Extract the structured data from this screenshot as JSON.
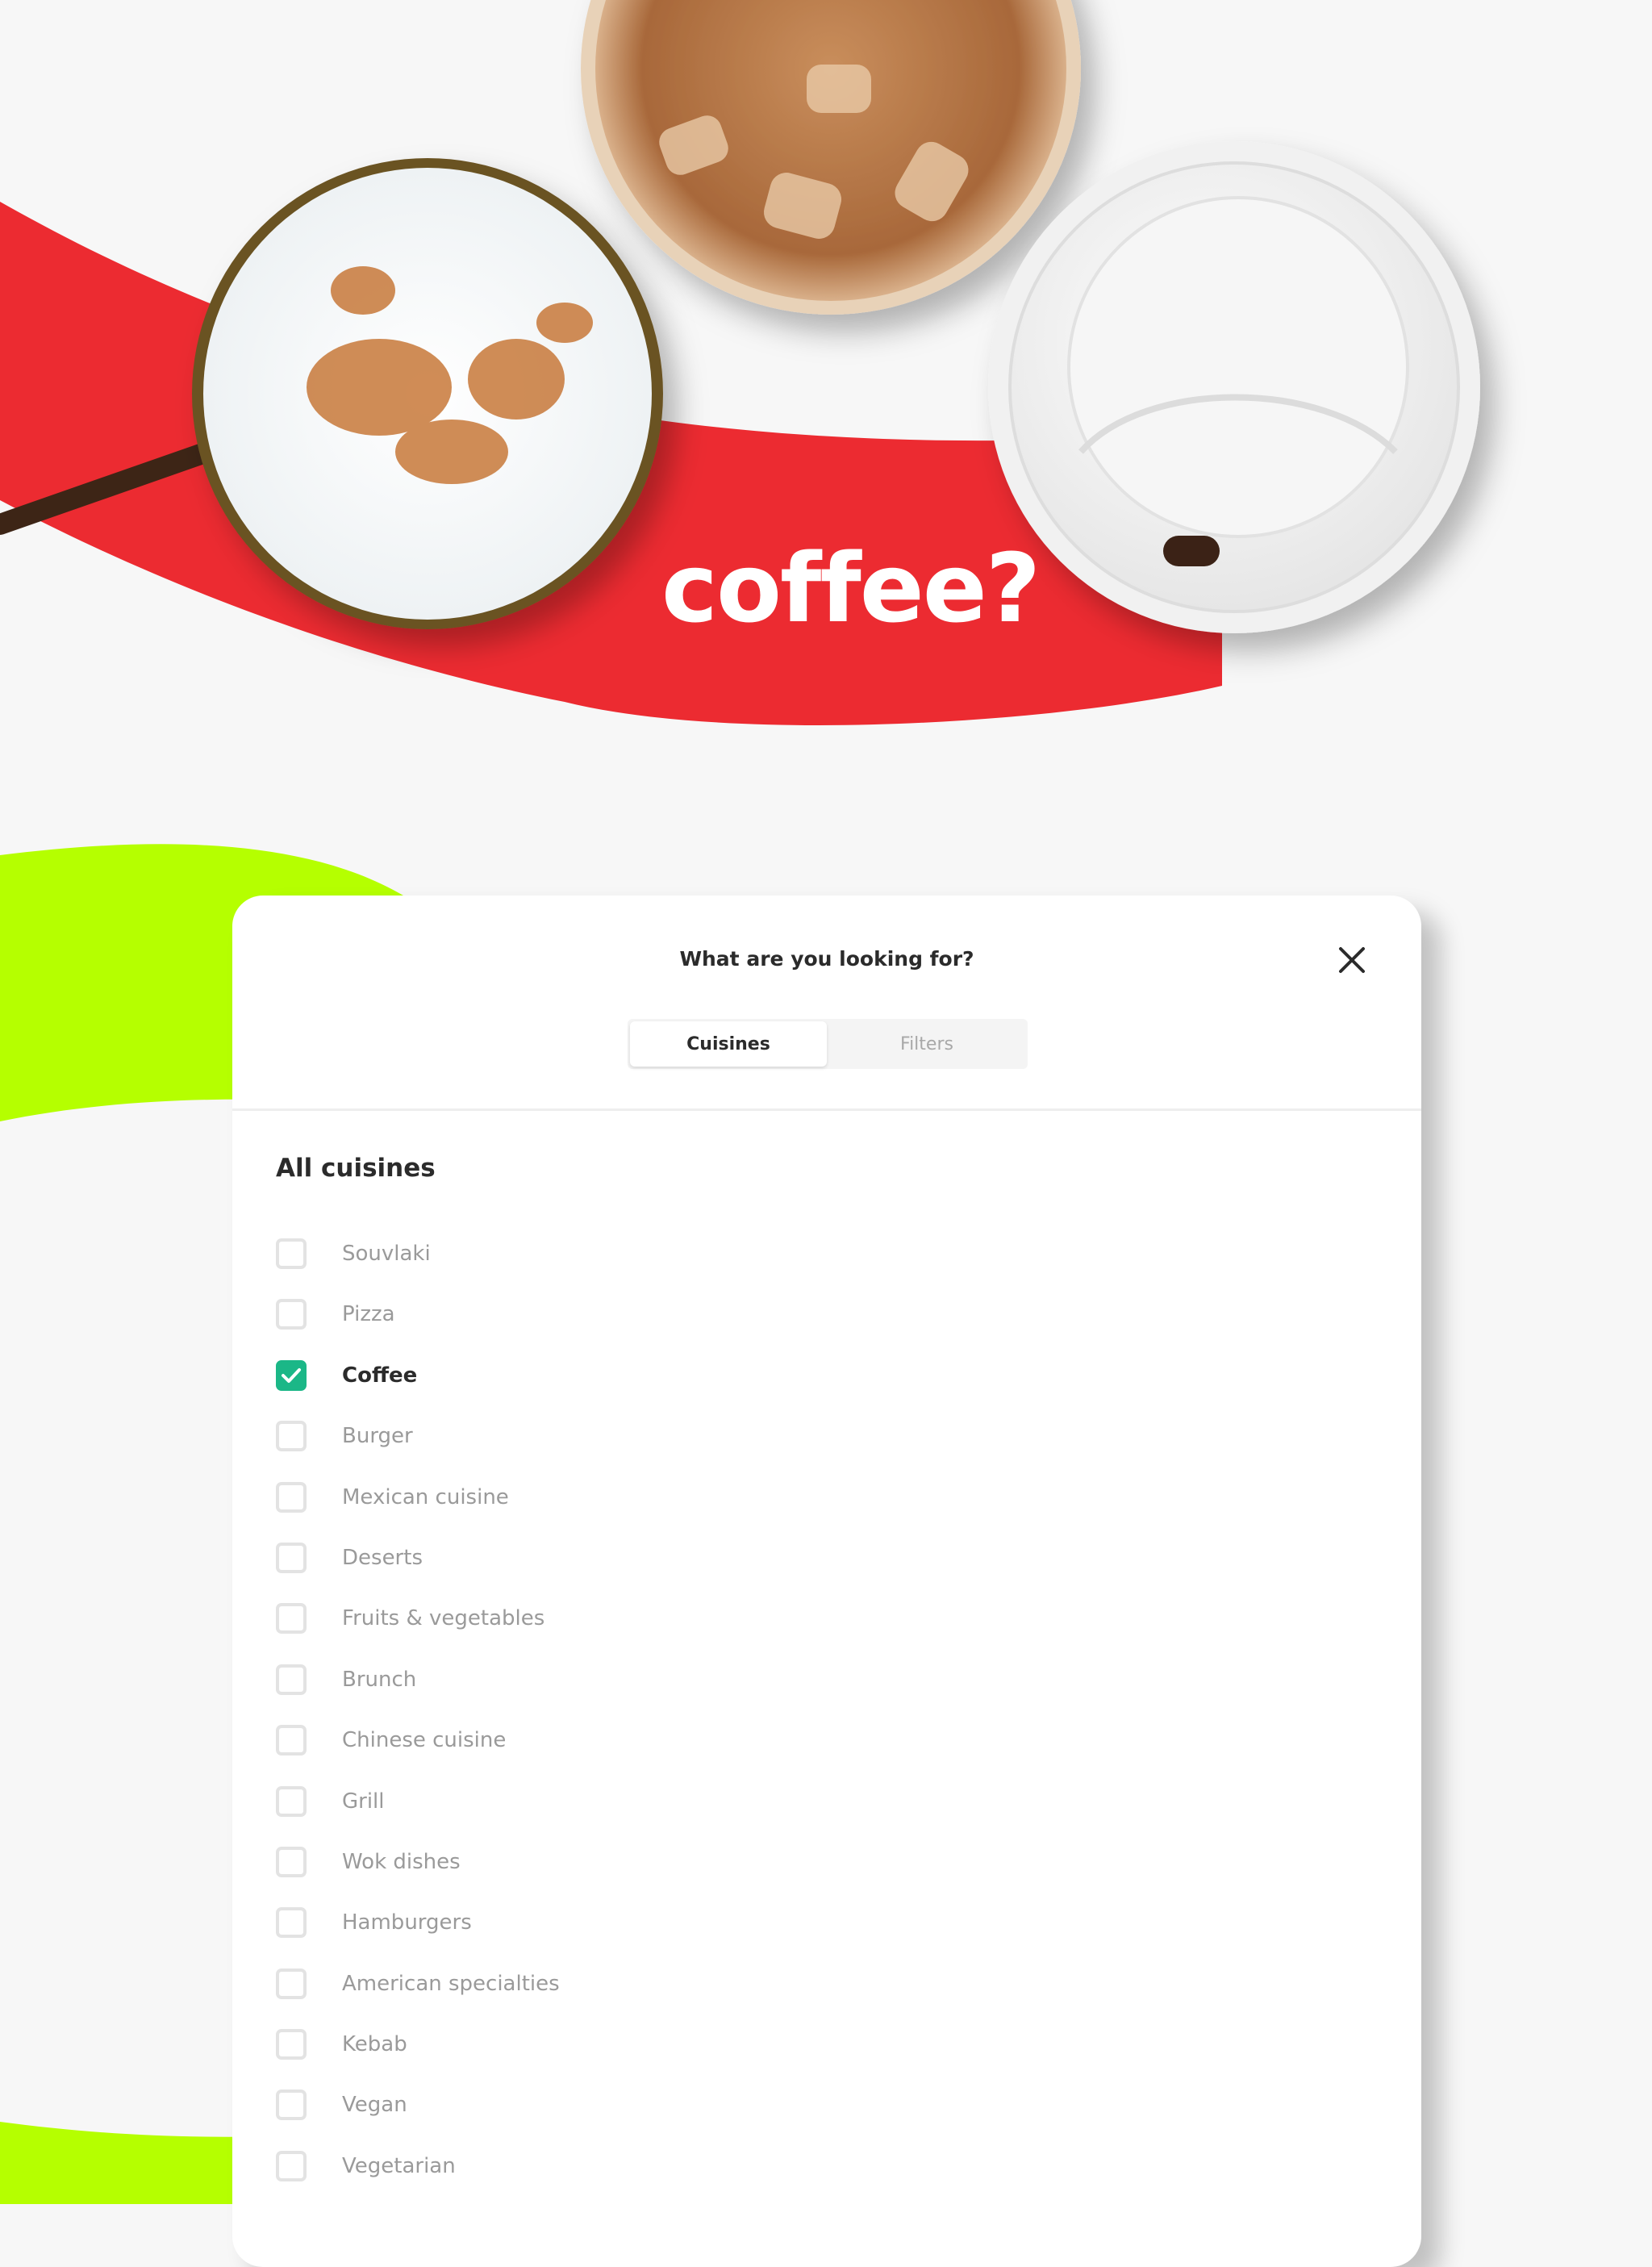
{
  "hero": {
    "headline": "coffee?",
    "colors": {
      "red": "#ec2b31",
      "lime": "#b5ff00",
      "background": "#f7f7f7"
    },
    "images": [
      "cappuccino-cup",
      "iced-coffee-cup",
      "takeaway-cup-lid"
    ]
  },
  "dialog": {
    "title": "What are you looking for?",
    "close_icon": "close-icon",
    "tabs": [
      {
        "label": "Cuisines",
        "active": true
      },
      {
        "label": "Filters",
        "active": false
      }
    ],
    "section_title": "All cuisines",
    "accent_color": "#1bb787",
    "cuisines": [
      {
        "label": "Souvlaki",
        "checked": false
      },
      {
        "label": "Pizza",
        "checked": false
      },
      {
        "label": "Coffee",
        "checked": true
      },
      {
        "label": "Burger",
        "checked": false
      },
      {
        "label": "Mexican cuisine",
        "checked": false
      },
      {
        "label": "Deserts",
        "checked": false
      },
      {
        "label": "Fruits & vegetables",
        "checked": false
      },
      {
        "label": "Brunch",
        "checked": false
      },
      {
        "label": "Chinese cuisine",
        "checked": false
      },
      {
        "label": "Grill",
        "checked": false
      },
      {
        "label": "Wok dishes",
        "checked": false
      },
      {
        "label": "Hamburgers",
        "checked": false
      },
      {
        "label": "American specialties",
        "checked": false
      },
      {
        "label": "Kebab",
        "checked": false
      },
      {
        "label": "Vegan",
        "checked": false
      },
      {
        "label": "Vegetarian",
        "checked": false
      }
    ]
  }
}
